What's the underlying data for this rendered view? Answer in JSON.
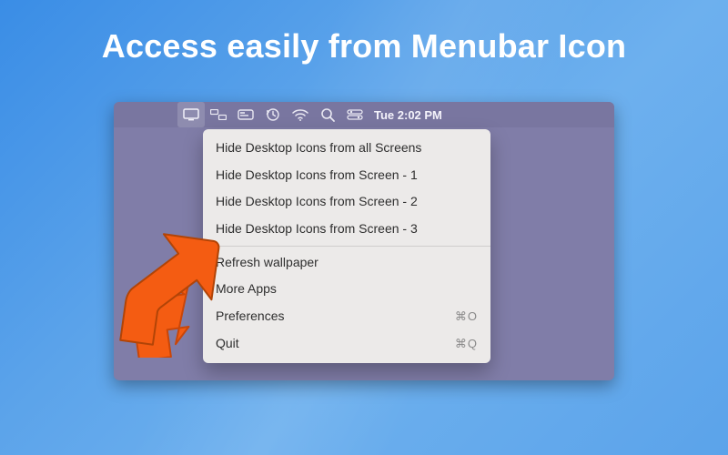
{
  "headline": "Access easily from Menubar Icon",
  "menubar": {
    "icons": [
      "display",
      "mission-control",
      "card",
      "time-machine",
      "wifi",
      "search",
      "control-center"
    ],
    "clock": "Tue 2:02 PM"
  },
  "menu": {
    "group1": [
      "Hide Desktop Icons from all Screens",
      "Hide Desktop Icons from Screen - 1",
      "Hide Desktop Icons from Screen - 2",
      "Hide Desktop Icons from Screen - 3"
    ],
    "group2": [
      {
        "label": "Refresh wallpaper",
        "shortcut": ""
      },
      {
        "label": "More Apps",
        "shortcut": ""
      },
      {
        "label": "Preferences",
        "shortcut": "⌘O"
      },
      {
        "label": "Quit",
        "shortcut": "⌘Q"
      }
    ]
  },
  "colors": {
    "arrow": "#f45c12"
  }
}
